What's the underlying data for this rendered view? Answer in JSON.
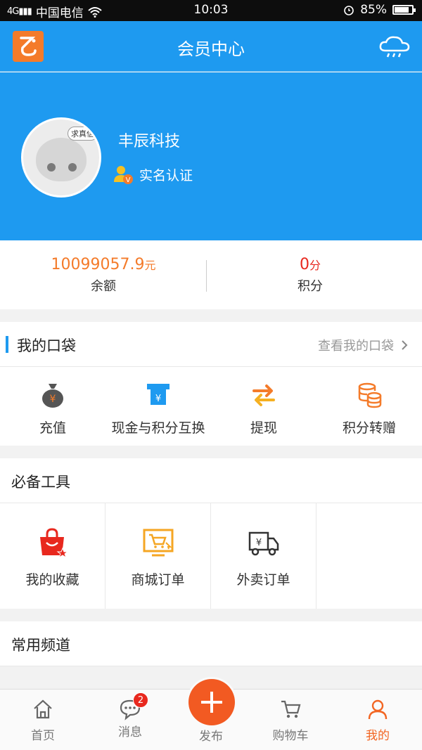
{
  "status_bar": {
    "carrier": "中国电信",
    "time": "10:03",
    "battery": "85%",
    "battery_level": 0.85
  },
  "header": {
    "title": "会员中心",
    "logo_icon": "app-logo-icon",
    "cloud_icon": "cloud-icon"
  },
  "profile": {
    "company": "丰辰科技",
    "verify_label": "实名认证",
    "avatar_bubble": "求真信"
  },
  "balance": {
    "amount_value": "10099057.9",
    "amount_unit": "元",
    "amount_label": "余额",
    "points_value": "0",
    "points_unit": "分",
    "points_label": "积分",
    "amount_color": "#f47b2a",
    "points_color": "#e8281e"
  },
  "pocket": {
    "title": "我的口袋",
    "more": "查看我的口袋",
    "items": [
      {
        "label": "充值",
        "icon": "money-bag-icon"
      },
      {
        "label": "现金与积分互换",
        "icon": "exchange-icon"
      },
      {
        "label": "提现",
        "icon": "transfer-arrows-icon"
      },
      {
        "label": "积分转赠",
        "icon": "coin-stack-icon"
      }
    ]
  },
  "tools": {
    "title": "必备工具",
    "items": [
      {
        "label": "我的收藏",
        "icon": "favorite-bag-icon"
      },
      {
        "label": "商城订单",
        "icon": "cart-screen-icon"
      },
      {
        "label": "外卖订单",
        "icon": "delivery-truck-icon"
      }
    ]
  },
  "channels": {
    "title": "常用频道"
  },
  "tabbar": {
    "items": [
      {
        "label": "首页",
        "icon": "home-icon"
      },
      {
        "label": "消息",
        "icon": "message-icon",
        "badge": "2"
      },
      {
        "label": "发布",
        "icon": "plus-icon"
      },
      {
        "label": "购物车",
        "icon": "cart-icon"
      },
      {
        "label": "我的",
        "icon": "user-icon"
      }
    ],
    "active_color": "#f26522"
  }
}
